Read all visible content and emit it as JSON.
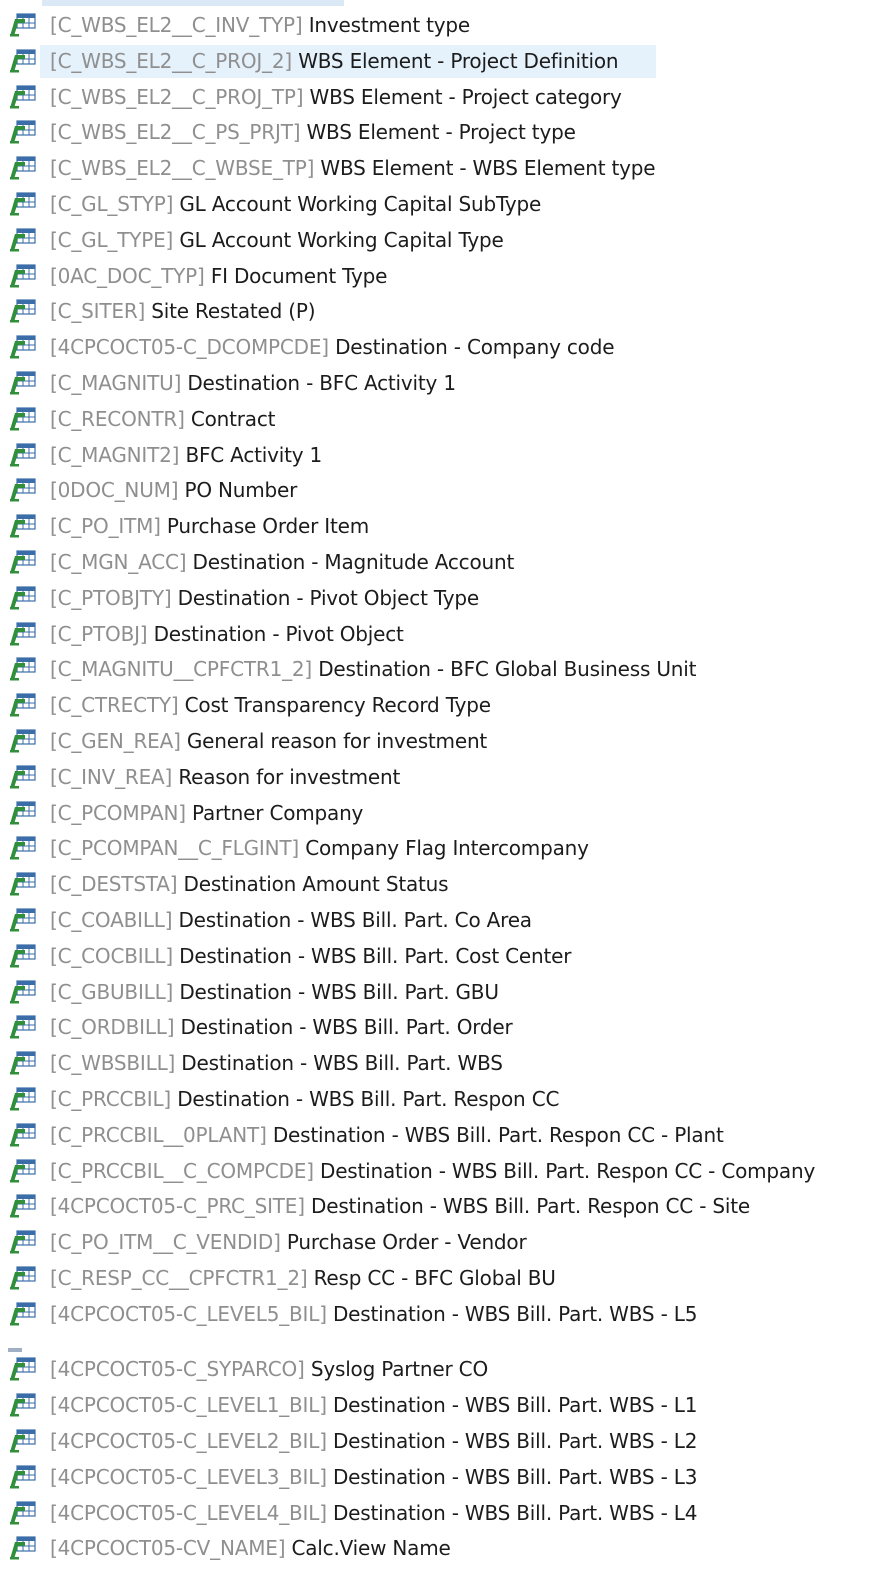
{
  "colors": {
    "technical_name": "#8f8f8f",
    "description": "#1c1c1c",
    "row_highlight": "#e5f1fb",
    "icon_green": "#2f8f3a",
    "icon_blue": "#3b6ea8"
  },
  "icon": "characteristic-table-icon",
  "rows": [
    {
      "tech": "[C_WBS_EL2__C_INV_TYP]",
      "desc": "Investment type"
    },
    {
      "tech": "[C_WBS_EL2__C_PROJ_2]",
      "desc": "WBS Element - Project Definition",
      "highlighted": true
    },
    {
      "tech": "[C_WBS_EL2__C_PROJ_TP]",
      "desc": "WBS Element - Project category"
    },
    {
      "tech": "[C_WBS_EL2__C_PS_PRJT]",
      "desc": "WBS Element - Project type"
    },
    {
      "tech": "[C_WBS_EL2__C_WBSE_TP]",
      "desc": "WBS Element - WBS Element type"
    },
    {
      "tech": "[C_GL_STYP]",
      "desc": "GL Account Working Capital SubType"
    },
    {
      "tech": "[C_GL_TYPE]",
      "desc": "GL Account Working Capital Type"
    },
    {
      "tech": "[0AC_DOC_TYP]",
      "desc": "FI Document Type"
    },
    {
      "tech": "[C_SITER]",
      "desc": "Site Restated (P)"
    },
    {
      "tech": "[4CPCOCT05-C_DCOMPCDE]",
      "desc": "Destination - Company code"
    },
    {
      "tech": "[C_MAGNITU]",
      "desc": "Destination - BFC Activity 1"
    },
    {
      "tech": "[C_RECONTR]",
      "desc": "Contract"
    },
    {
      "tech": "[C_MAGNIT2]",
      "desc": "BFC Activity 1"
    },
    {
      "tech": "[0DOC_NUM]",
      "desc": "PO Number"
    },
    {
      "tech": "[C_PO_ITM]",
      "desc": "Purchase Order Item"
    },
    {
      "tech": "[C_MGN_ACC]",
      "desc": "Destination - Magnitude Account"
    },
    {
      "tech": "[C_PTOBJTY]",
      "desc": "Destination - Pivot Object Type"
    },
    {
      "tech": "[C_PTOBJ]",
      "desc": "Destination - Pivot Object"
    },
    {
      "tech": "[C_MAGNITU__CPFCTR1_2]",
      "desc": "Destination - BFC Global Business Unit"
    },
    {
      "tech": "[C_CTRECTY]",
      "desc": "Cost Transparency Record Type"
    },
    {
      "tech": "[C_GEN_REA]",
      "desc": "General reason for investment"
    },
    {
      "tech": "[C_INV_REA]",
      "desc": "Reason for investment"
    },
    {
      "tech": "[C_PCOMPAN]",
      "desc": "Partner Company"
    },
    {
      "tech": "[C_PCOMPAN__C_FLGINT]",
      "desc": "Company Flag Intercompany"
    },
    {
      "tech": "[C_DESTSTA]",
      "desc": "Destination Amount Status"
    },
    {
      "tech": "[C_COABILL]",
      "desc": "Destination - WBS Bill.  Part. Co Area"
    },
    {
      "tech": "[C_COCBILL]",
      "desc": "Destination - WBS Bill. Part. Cost Center"
    },
    {
      "tech": "[C_GBUBILL]",
      "desc": "Destination - WBS Bill. Part. GBU"
    },
    {
      "tech": "[C_ORDBILL]",
      "desc": "Destination - WBS Bill. Part. Order"
    },
    {
      "tech": "[C_WBSBILL]",
      "desc": "Destination - WBS Bill. Part. WBS"
    },
    {
      "tech": "[C_PRCCBIL]",
      "desc": "Destination - WBS Bill. Part. Respon CC"
    },
    {
      "tech": "[C_PRCCBIL__0PLANT]",
      "desc": "Destination - WBS Bill. Part. Respon CC - Plant"
    },
    {
      "tech": "[C_PRCCBIL__C_COMPCDE]",
      "desc": "Destination - WBS Bill. Part. Respon CC - Company"
    },
    {
      "tech": "[4CPCOCT05-C_PRC_SITE]",
      "desc": "Destination - WBS Bill. Part. Respon CC - Site"
    },
    {
      "tech": "[C_PO_ITM__C_VENDID]",
      "desc": "Purchase Order - Vendor"
    },
    {
      "tech": "[C_RESP_CC__CPFCTR1_2]",
      "desc": "Resp CC - BFC Global BU"
    },
    {
      "tech": "[4CPCOCT05-C_LEVEL5_BIL]",
      "desc": "Destination - WBS Bill. Part. WBS - L5"
    },
    {
      "tech": "[4CPCOCT05-C_SYPARCO]",
      "desc": "Syslog Partner CO",
      "gap_before": true
    },
    {
      "tech": "[4CPCOCT05-C_LEVEL1_BIL]",
      "desc": "Destination - WBS Bill. Part. WBS - L1"
    },
    {
      "tech": "[4CPCOCT05-C_LEVEL2_BIL]",
      "desc": "Destination - WBS Bill. Part. WBS - L2"
    },
    {
      "tech": "[4CPCOCT05-C_LEVEL3_BIL]",
      "desc": "Destination - WBS Bill. Part. WBS - L3"
    },
    {
      "tech": "[4CPCOCT05-C_LEVEL4_BIL]",
      "desc": "Destination - WBS Bill. Part. WBS - L4"
    },
    {
      "tech": "[4CPCOCT05-CV_NAME]",
      "desc": "Calc.View Name"
    }
  ]
}
